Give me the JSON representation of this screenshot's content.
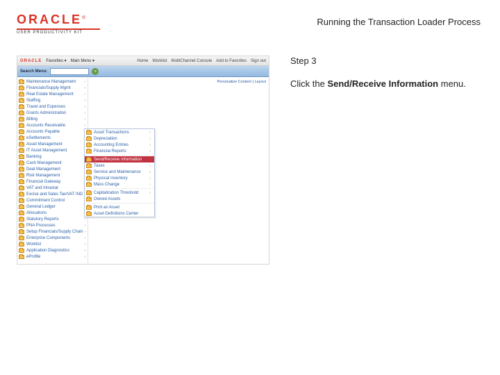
{
  "header": {
    "brand": "ORACLE",
    "tm": "®",
    "product_line": "USER PRODUCTIVITY KIT",
    "doc_title": "Running the Transaction Loader Process"
  },
  "instruction": {
    "step_label": "Step 3",
    "text_pre": "Click the ",
    "bold": "Send/Receive Information",
    "text_post": " menu."
  },
  "app": {
    "header": {
      "favorites": "Favorites ▾",
      "main_menu": "Main Menu ▾",
      "links": [
        "Home",
        "Worklist",
        "MultiChannel Console",
        "Add to Favorites",
        "Sign out"
      ]
    },
    "toolbar": {
      "label": "Search Menu:",
      "placeholder": ""
    },
    "personalize": "Personalize Content | Layout",
    "leftnav": [
      "Maintenance Management",
      "Financials/Supply Mgmt",
      "Real Estate Management",
      "Staffing",
      "Travel and Expenses",
      "Grants Administration",
      "Billing",
      "Accounts Receivable",
      "Accounts Payable",
      "eSettlements",
      "Asset Management",
      "IT Asset Management",
      "Banking",
      "Cash Management",
      "Deal Management",
      "Risk Management",
      "Financial Gateway",
      "VAT and Intrastat",
      "Excise and Sales Tax/VAT IND",
      "Commitment Control",
      "General Ledger",
      "Allocations",
      "Statutory Reports",
      "PNA Processes",
      "Setup Financials/Supply Chain",
      "Enterprise Components",
      "Worklist",
      "Application Diagnostics",
      "eProfile"
    ],
    "submenu": [
      "Asset Transactions",
      "Depreciation",
      "Accounting Entries",
      "Financial Reports",
      "Send/Receive Information",
      "Taxes",
      "Service and Maintenance",
      "Physical Inventory",
      "Mass Change",
      "Capitalization Threshold",
      "Owned Assets",
      "Print an Asset",
      "Asset Definitions Center"
    ],
    "highlight_index": 4
  }
}
